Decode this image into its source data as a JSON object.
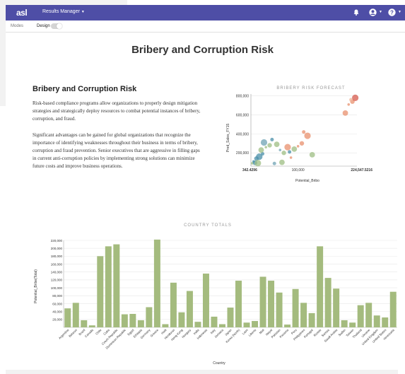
{
  "app": {
    "logo": "asl",
    "menu_label": "Results Manager",
    "modes_label": "Modes",
    "design_label": "Design"
  },
  "page": {
    "title": "Bribery and Corruption Risk",
    "section_title": "Bribery and Corruption Risk",
    "paragraph1": "Risk-based compliance programs allow organizations to properly design mitigation strategies and strategically deploy resources to combat potential instances of bribery, corruption, and fraud.",
    "paragraph2": "Significant advantages can be gained for global organizations that recognize the importance of identifying weaknesses throughout their business in terms of bribery, corruption and fraud prevention. Senior executives that are aggressive in filling gaps in current anti-corruption policies by implementing strong solutions can minimize future costs and improve business operations."
  },
  "icons": {
    "bell": "bell-icon",
    "user": "user-icon",
    "help": "help-icon"
  },
  "colors": {
    "topbar": "#4e4ea6",
    "bar": "#a4bb7e"
  },
  "chart_data": [
    {
      "type": "scatter",
      "title": "BRIBERY RISK FORECAST",
      "xlabel": "Potential_Bribo",
      "ylabel": "Pred_Sales_FY15",
      "x_tick_labels": [
        "342.4296",
        "100,000",
        "224,547.5216"
      ],
      "y_tick_labels": [
        "200,000",
        "400,000",
        "600,000",
        "800,000"
      ],
      "xlim": [
        342.4296,
        224547.5216
      ],
      "ylim": [
        60000,
        820000
      ],
      "grid": true,
      "points": [
        {
          "x": 6000,
          "y": 110000,
          "c": "#4a8fa8"
        },
        {
          "x": 12000,
          "y": 140000,
          "c": "#4a8fa8"
        },
        {
          "x": 18000,
          "y": 160000,
          "c": "#4a8fa8"
        },
        {
          "x": 25000,
          "y": 190000,
          "c": "#4a8fa8"
        },
        {
          "x": 22000,
          "y": 230000,
          "c": "#9ebd83"
        },
        {
          "x": 32000,
          "y": 260000,
          "c": "#9ebd83"
        },
        {
          "x": 40000,
          "y": 280000,
          "c": "#9ebd83"
        },
        {
          "x": 28000,
          "y": 310000,
          "c": "#6fa3b4"
        },
        {
          "x": 45000,
          "y": 340000,
          "c": "#4a8fa8"
        },
        {
          "x": 55000,
          "y": 290000,
          "c": "#9ebd83"
        },
        {
          "x": 62000,
          "y": 230000,
          "c": "#6fa3b4"
        },
        {
          "x": 70000,
          "y": 200000,
          "c": "#9ebd83"
        },
        {
          "x": 78000,
          "y": 260000,
          "c": "#e8906d"
        },
        {
          "x": 82000,
          "y": 210000,
          "c": "#4a8fa8"
        },
        {
          "x": 92000,
          "y": 240000,
          "c": "#9ebd83"
        },
        {
          "x": 100000,
          "y": 270000,
          "c": "#e8906d"
        },
        {
          "x": 108000,
          "y": 300000,
          "c": "#e8906d"
        },
        {
          "x": 120000,
          "y": 380000,
          "c": "#e8906d"
        },
        {
          "x": 112000,
          "y": 420000,
          "c": "#e8906d"
        },
        {
          "x": 200000,
          "y": 620000,
          "c": "#e8906d"
        },
        {
          "x": 207000,
          "y": 710000,
          "c": "#e8906d"
        },
        {
          "x": 215000,
          "y": 740000,
          "c": "#e8906d"
        },
        {
          "x": 221000,
          "y": 780000,
          "c": "#d65a4c"
        },
        {
          "x": 212000,
          "y": 760000,
          "c": "#f0b69b"
        },
        {
          "x": 130000,
          "y": 180000,
          "c": "#9ebd83"
        },
        {
          "x": 3000,
          "y": 90000,
          "c": "#9ebd83"
        },
        {
          "x": 9000,
          "y": 95000,
          "c": "#4a8fa8"
        },
        {
          "x": 15000,
          "y": 92000,
          "c": "#9ebd83"
        },
        {
          "x": 50000,
          "y": 88000,
          "c": "#6fa3b4"
        },
        {
          "x": 66000,
          "y": 100000,
          "c": "#9ebd83"
        },
        {
          "x": 85000,
          "y": 150000,
          "c": "#e8906d"
        }
      ]
    },
    {
      "type": "bar",
      "title": "COUNTRY TOTALS",
      "xlabel": "Country",
      "ylabel": "Potential_Bribe(Total)",
      "ylim": [
        0,
        220000
      ],
      "grid": true,
      "y_tick_labels": [
        "20,000",
        "40,000",
        "60,000",
        "80,000",
        "100,000",
        "120,000",
        "140,000",
        "160,000",
        "180,000",
        "200,000",
        "220,000"
      ],
      "categories": [
        "Argentina",
        "Belarus",
        "Brazil",
        "Canada",
        "Chile",
        "China",
        "Cuba",
        "Czech Republic",
        "Dominican Republic",
        "Egypt",
        "Ethiopia",
        "Germany",
        "Greece",
        "Haiti",
        "Honduras",
        "Hong Kong",
        "Hungary",
        "India",
        "Indonesia",
        "Israel",
        "Italy",
        "Jamaica",
        "Japan",
        "Korea (North)",
        "Laos",
        "Liberia",
        "Mali",
        "Nepal",
        "Pakistan",
        "Panama",
        "Peru",
        "Philippines",
        "Portugal",
        "Russia",
        "Samoa",
        "Saudi Arabia",
        "Sudan",
        "Taiwan",
        "Thailand",
        "Ukraine",
        "United Kingdom",
        "United States",
        "Venezuela"
      ],
      "x_tick_labels": [
        "Argentina",
        "Belarus",
        "Brazil",
        "Canada",
        "Chile",
        "Cuba",
        "Czech Republic",
        "Dominican Republic",
        "Egypt",
        "Ethiopia",
        "Germany",
        "Greece",
        "Haiti",
        "Honduras",
        "Hong Kong",
        "Hungary",
        "India",
        "Indonesia",
        "Italy",
        "Jamaica",
        "Japan",
        "Korea (North)",
        "Laos",
        "Liberia",
        "Mali",
        "Nepal",
        "Pakistan",
        "Panama",
        "Peru",
        "Philippines",
        "Portugal",
        "Russia",
        "Samoa",
        "Saudi Arabia",
        "Sudan",
        "Taiwan",
        "Thailand",
        "Ukraine",
        "United Kingdom",
        "United States",
        "Venezuela"
      ],
      "values": [
        48000,
        62000,
        18000,
        5000,
        180000,
        205000,
        210000,
        33000,
        34000,
        18000,
        51000,
        222000,
        8000,
        113000,
        38000,
        92000,
        14000,
        136000,
        27000,
        8000,
        50000,
        118000,
        12000,
        16000,
        128000,
        118000,
        88000,
        7000,
        97000,
        62000,
        36000,
        205000,
        125000,
        98000,
        18000,
        12000,
        56000,
        62000,
        30000,
        25000,
        90000
      ]
    }
  ]
}
